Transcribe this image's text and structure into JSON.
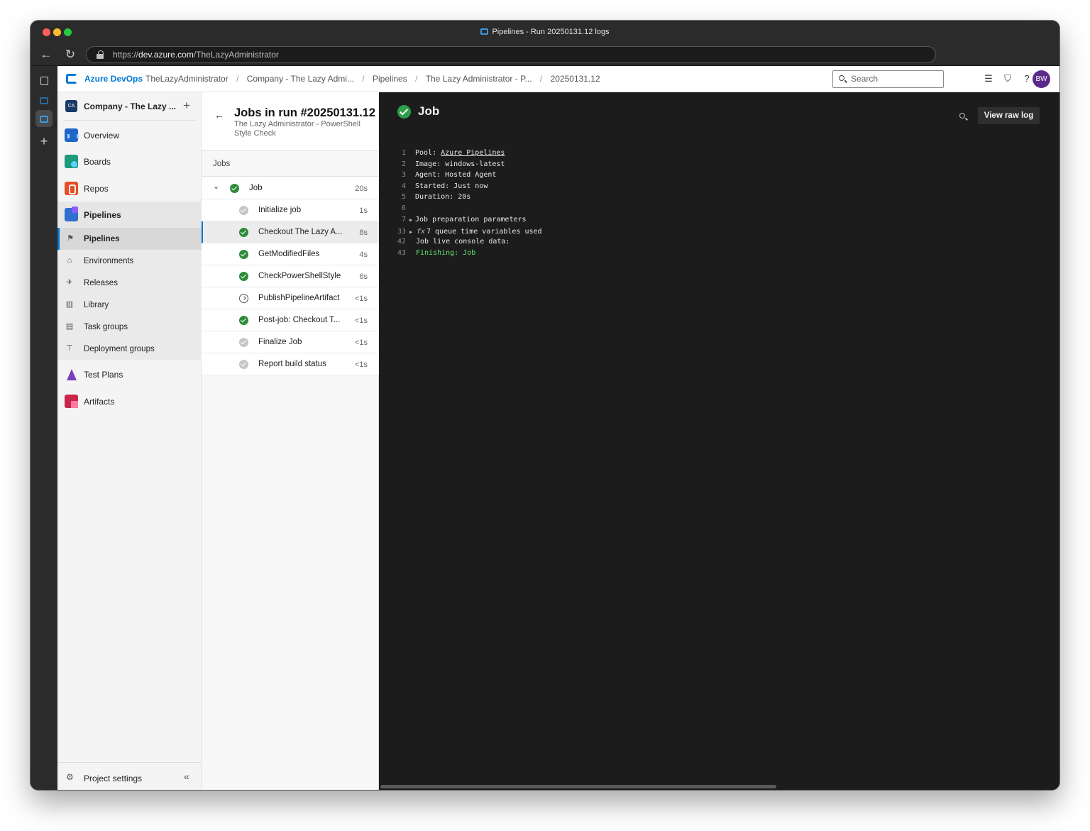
{
  "window": {
    "title": "Pipelines - Run 20250131.12 logs"
  },
  "browser": {
    "url_scheme": "https://",
    "url_host": "dev.azure.com",
    "url_path": "/TheLazyAdministrator"
  },
  "topbar": {
    "brand": "Azure DevOps",
    "breadcrumbs": [
      "TheLazyAdministrator",
      "Company - The Lazy Admi...",
      "Pipelines",
      "The Lazy Administrator - P...",
      "20250131.12"
    ],
    "search_placeholder": "Search",
    "avatar_initials": "BW"
  },
  "project": {
    "badge": "CA",
    "name": "Company - The Lazy ...",
    "add_symbol": "+"
  },
  "nav": {
    "overview": "Overview",
    "boards": "Boards",
    "repos": "Repos",
    "pipelines": "Pipelines",
    "sub": {
      "pipelines": "Pipelines",
      "environments": "Environments",
      "releases": "Releases",
      "library": "Library",
      "task_groups": "Task groups",
      "deployment_groups": "Deployment groups"
    },
    "test_plans": "Test Plans",
    "artifacts": "Artifacts",
    "project_settings": "Project settings",
    "collapse_symbol": "«"
  },
  "jobs_panel": {
    "title": "Jobs in run #20250131.12",
    "subtitle": "The Lazy Administrator - PowerShell Style Check",
    "section_label": "Jobs",
    "parent_job": {
      "name": "Job",
      "duration": "20s",
      "status": "succeeded"
    },
    "steps": [
      {
        "name": "Initialize job",
        "duration": "1s",
        "status": "skipped-check"
      },
      {
        "name": "Checkout The Lazy A...",
        "duration": "8s",
        "status": "succeeded"
      },
      {
        "name": "GetModifiedFiles",
        "duration": "4s",
        "status": "succeeded"
      },
      {
        "name": "CheckPowerShellStyle",
        "duration": "6s",
        "status": "succeeded"
      },
      {
        "name": "PublishPipelineArtifact",
        "duration": "<1s",
        "status": "not-run"
      },
      {
        "name": "Post-job: Checkout T...",
        "duration": "<1s",
        "status": "succeeded"
      },
      {
        "name": "Finalize Job",
        "duration": "<1s",
        "status": "skipped-check"
      },
      {
        "name": "Report build status",
        "duration": "<1s",
        "status": "skipped-check"
      }
    ]
  },
  "log": {
    "title": "Job",
    "view_raw_label": "View raw log",
    "lines": [
      {
        "num": "1",
        "text": "Pool: ",
        "link": "Azure Pipelines"
      },
      {
        "num": "2",
        "text": "Image: windows-latest"
      },
      {
        "num": "3",
        "text": "Agent: Hosted Agent"
      },
      {
        "num": "4",
        "text": "Started: Just now"
      },
      {
        "num": "5",
        "text": "Duration: 20s"
      },
      {
        "num": "6",
        "text": ""
      },
      {
        "num": "7",
        "text": "Job preparation parameters",
        "collapsible": true
      },
      {
        "num": "33",
        "text": "7 queue time variables used",
        "collapsible": true,
        "fx": "fx"
      },
      {
        "num": "42",
        "text": "Job live console data:"
      },
      {
        "num": "43",
        "text": "Finishing: Job",
        "color": "#5fe36b"
      }
    ]
  },
  "colors": {
    "accent": "#0078d4",
    "success": "#2e8b3a",
    "avatar": "#5b2b8c",
    "log_bg": "#1c1c1c"
  }
}
